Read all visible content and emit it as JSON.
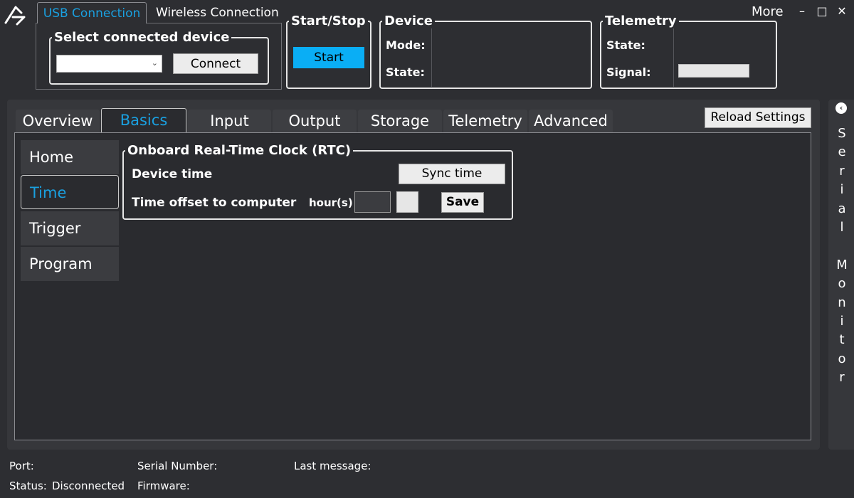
{
  "top": {
    "connection_tabs": [
      "USB Connection",
      "Wireless Connection"
    ],
    "select_group": {
      "title": "Select connected device",
      "dropdown_value": "",
      "connect_label": "Connect"
    },
    "start_stop": {
      "title": "Start/Stop",
      "start_label": "Start"
    },
    "device": {
      "title": "Device",
      "mode_label": "Mode:",
      "state_label": "State:"
    },
    "telemetry": {
      "title": "Telemetry",
      "state_label": "State:",
      "signal_label": "Signal:"
    },
    "more_label": "More",
    "window_controls": [
      "–",
      "□",
      "✕"
    ]
  },
  "tabs": [
    "Overview",
    "Basics",
    "Input",
    "Output",
    "Storage",
    "Telemetry",
    "Advanced"
  ],
  "active_tab": "Basics",
  "reload_label": "Reload Settings",
  "sidebar": {
    "items": [
      "Home",
      "Time",
      "Trigger",
      "Program"
    ],
    "active": "Time"
  },
  "rtc": {
    "title": "Onboard Real-Time Clock (RTC)",
    "device_time_label": "Device time",
    "sync_label": "Sync time",
    "offset_label": "Time offset to computer",
    "unit_label": "hour(s)",
    "save_label": "Save"
  },
  "serial_monitor": {
    "label": "S\ne\nr\ni\na\nl\n\nM\no\nn\ni\nt\no\nr",
    "toggle_icon": "‹"
  },
  "status_bar": {
    "port_label": "Port:",
    "status_label": "Status:",
    "status_value": "Disconnected",
    "serial_label": "Serial Number:",
    "firmware_label": "Firmware:",
    "last_message_label": "Last message:"
  },
  "colors": {
    "accent": "#1aa0e0",
    "start_button": "#0aaef5",
    "background": "#2d2e32"
  }
}
